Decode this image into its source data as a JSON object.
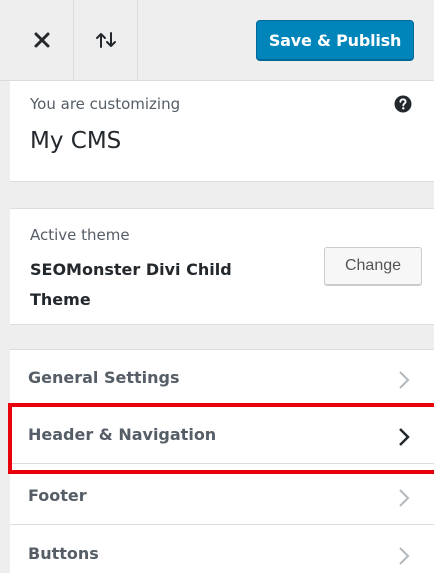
{
  "header": {
    "close_icon": "close-icon",
    "sort_icon": "reorder-icon",
    "publish_label": "Save & Publish",
    "publish_color": "#0085ba"
  },
  "info": {
    "label": "You are customizing",
    "title": "My CMS",
    "help_icon": "help-icon"
  },
  "theme": {
    "label": "Active theme",
    "name": "SEOMonster Divi Child Theme",
    "change_label": "Change"
  },
  "sections": [
    {
      "label": "General Settings",
      "icon": "chevron-right-icon"
    },
    {
      "label": "Header & Navigation",
      "icon": "chevron-right-icon",
      "highlighted": true
    },
    {
      "label": "Footer",
      "icon": "chevron-right-icon"
    },
    {
      "label": "Buttons",
      "icon": "chevron-right-icon"
    }
  ],
  "colors": {
    "highlight": "#e8000b",
    "panel_bg": "#eeeeee"
  }
}
